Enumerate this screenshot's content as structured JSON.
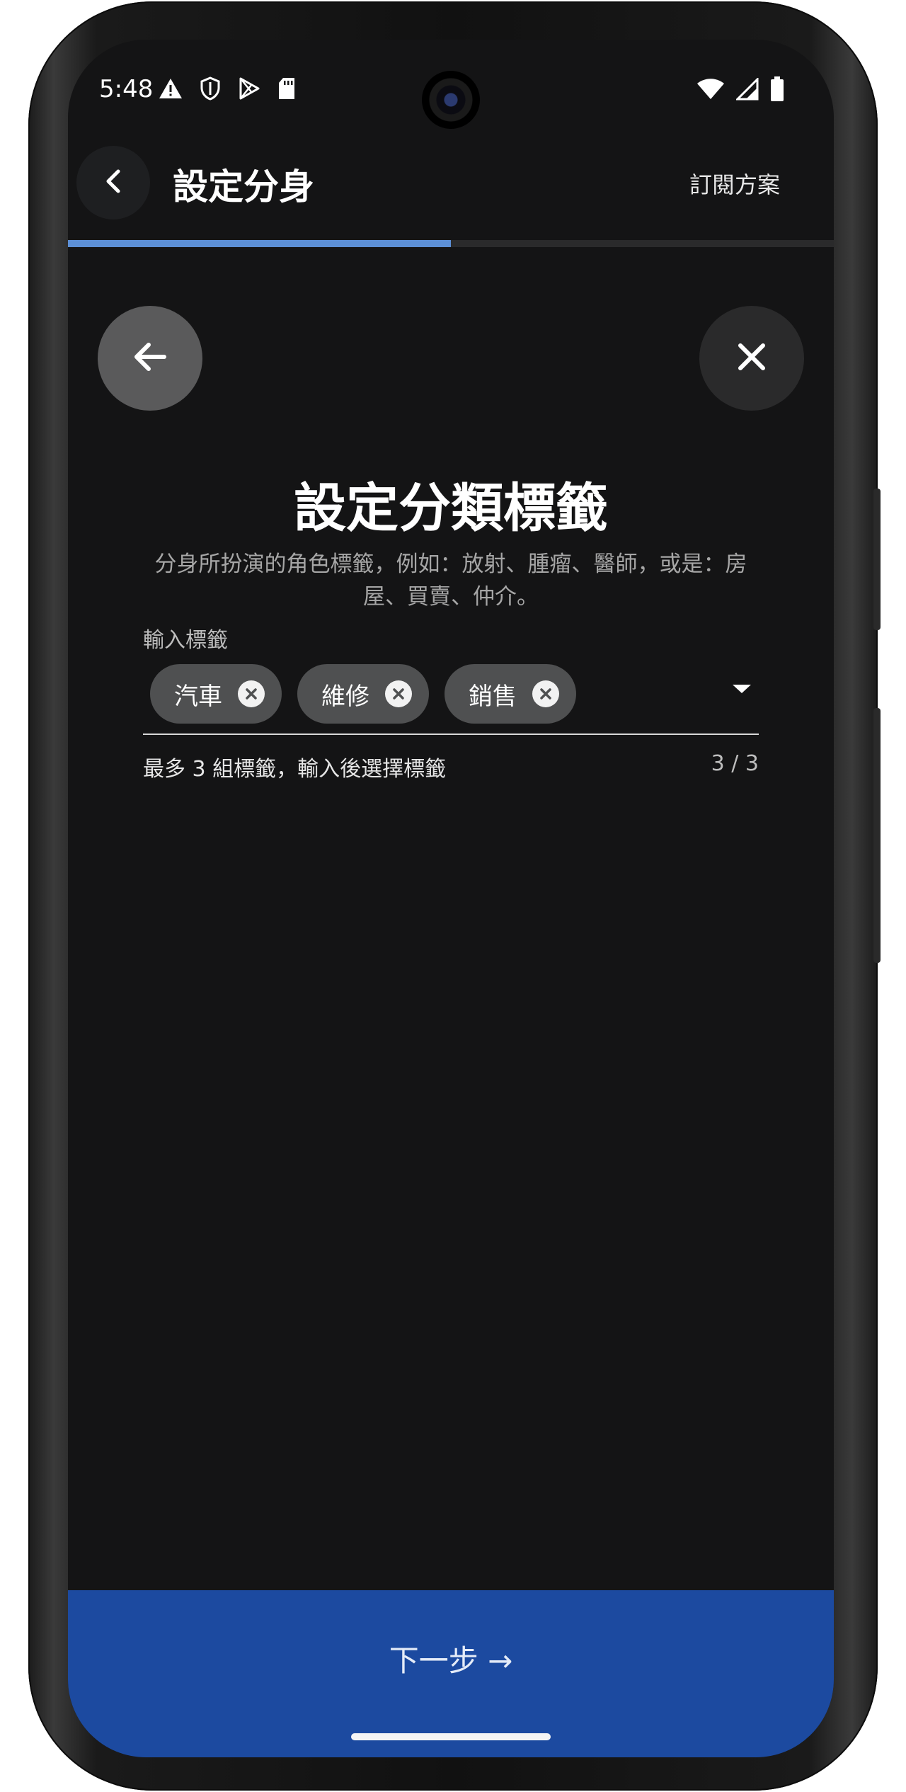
{
  "status_bar": {
    "time": "5:48",
    "left_icons": [
      "warning-icon",
      "shield-icon",
      "play-store-icon",
      "sd-card-icon"
    ],
    "right_icons": [
      "wifi-icon",
      "signal-icon",
      "battery-icon"
    ]
  },
  "top_bar": {
    "title": "設定分身",
    "subscribe_label": "訂閱方案"
  },
  "progress": {
    "fraction": 0.5,
    "color": "#5c8fd6"
  },
  "page": {
    "heading": "設定分類標籤",
    "description": "分身所扮演的角色標籤，例如：放射、腫瘤、醫師，或是：房屋、買賣、仲介。"
  },
  "tag_field": {
    "label": "輸入標籤",
    "tags": [
      {
        "label": "汽車"
      },
      {
        "label": "維修"
      },
      {
        "label": "銷售"
      }
    ],
    "helper_text": "最多 3 組標籤，輸入後選擇標籤",
    "counter": "3 / 3"
  },
  "bottom": {
    "next_label": "下一步 →",
    "color": "#1c4aa0"
  }
}
